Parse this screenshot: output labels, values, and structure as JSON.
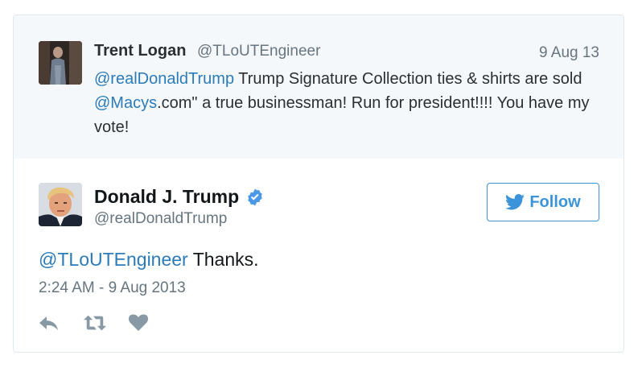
{
  "quoted_tweet": {
    "name": "Trent Logan",
    "handle": "@TLoUTEngineer",
    "date": "9 Aug 13",
    "mention_trump": "@realDonaldTrump",
    "text_part1": " Trump Signature Collection ties & shirts are sold ",
    "mention_macys": "@Macys",
    "text_part2": ".com\" a true businessman! Run for president!!!! You have my vote!"
  },
  "tweet": {
    "name": "Donald J. Trump",
    "handle": "@realDonaldTrump",
    "follow_label": "Follow",
    "reply_mention": "@TLoUTEngineer",
    "text": " Thanks.",
    "timestamp": "2:24 AM - 9 Aug 2013"
  },
  "colors": {
    "link": "#2b7bb9",
    "verified": "#4a99e9",
    "follow": "#3b94d9",
    "quoted_background": "#f5f8fa",
    "icon": "#8899a6"
  },
  "icons": [
    "verified-badge-icon",
    "twitter-bird-icon",
    "reply-icon",
    "retweet-icon",
    "like-heart-icon"
  ]
}
